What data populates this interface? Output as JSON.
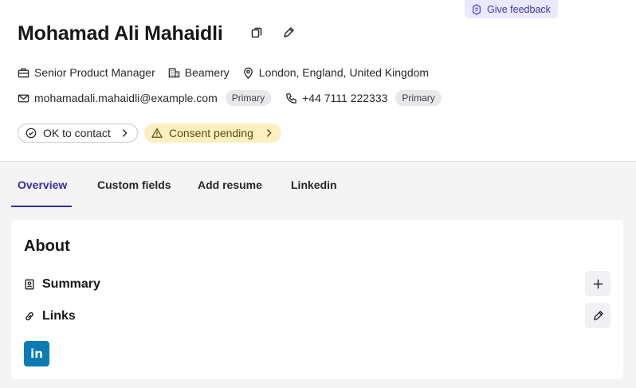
{
  "feedback": {
    "label": "Give feedback",
    "icon": "feedback-icon"
  },
  "profile": {
    "name": "Mohamad Ali Mahaidli",
    "title": "Senior Product Manager",
    "company": "Beamery",
    "location": "London, England, United Kingdom",
    "email": "mohamadali.mahaidli@example.com",
    "email_badge": "Primary",
    "phone": "+44 7111 222333",
    "phone_badge": "Primary"
  },
  "statuses": {
    "contact": "OK to contact",
    "consent": "Consent pending"
  },
  "tabs": [
    {
      "label": "Overview",
      "active": true
    },
    {
      "label": "Custom fields",
      "active": false
    },
    {
      "label": "Add resume",
      "active": false
    },
    {
      "label": "Linkedin",
      "active": false
    }
  ],
  "about": {
    "title": "About",
    "summary_label": "Summary",
    "links_label": "Links",
    "linkedin_glyph": "in"
  },
  "colors": {
    "accent": "#3730a3",
    "pending_bg": "#fdefbf",
    "linkedin": "#0a7bb5"
  }
}
